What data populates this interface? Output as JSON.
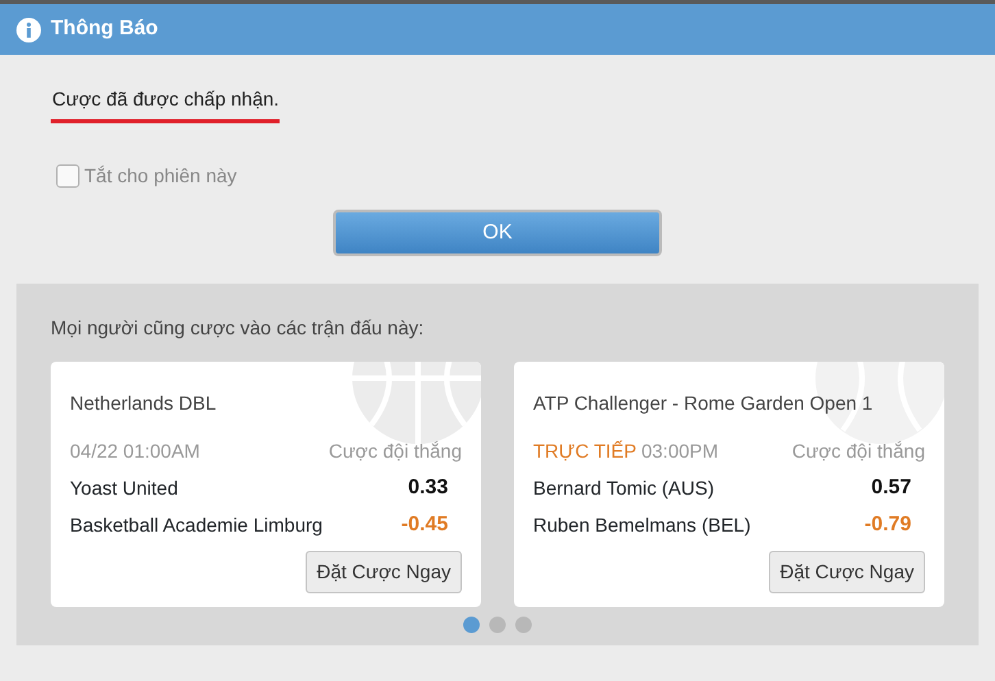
{
  "window": {
    "title": "Thông Báo"
  },
  "message": {
    "text": "Cược đã được chấp nhận.",
    "underlined": true
  },
  "checkbox": {
    "label": "Tắt cho phiên này",
    "checked": false,
    "disabled": true
  },
  "ok_button": "OK",
  "suggestions": {
    "heading": "Mọi người cũng cược vào các trận đấu này:",
    "cards": [
      {
        "league": "Netherlands DBL",
        "kind": "basketball",
        "time": "04/22 01:00AM",
        "bet_type": "Cược đội thắng",
        "teams": [
          {
            "name": "Yoast United",
            "odds": "0.33",
            "color": "#111111"
          },
          {
            "name": "Basketball Academie Limburg",
            "odds": "-0.45",
            "color": "#e07b24"
          }
        ],
        "button": "Đặt Cược Ngay"
      },
      {
        "league": "ATP Challenger - Rome Garden Open 1",
        "kind": "tennis",
        "live_label": "TRỰC TIẾP",
        "time": "03:00PM",
        "bet_type": "Cược đội thắng",
        "teams": [
          {
            "name": "Bernard Tomic (AUS)",
            "odds": "0.57",
            "color": "#111111"
          },
          {
            "name": "Ruben Bemelmans (BEL)",
            "odds": "-0.79",
            "color": "#e07b24"
          }
        ],
        "button": "Đặt Cược Ngay"
      }
    ],
    "pager": [
      {
        "selected": true
      },
      {
        "selected": false
      },
      {
        "selected": false
      }
    ]
  }
}
